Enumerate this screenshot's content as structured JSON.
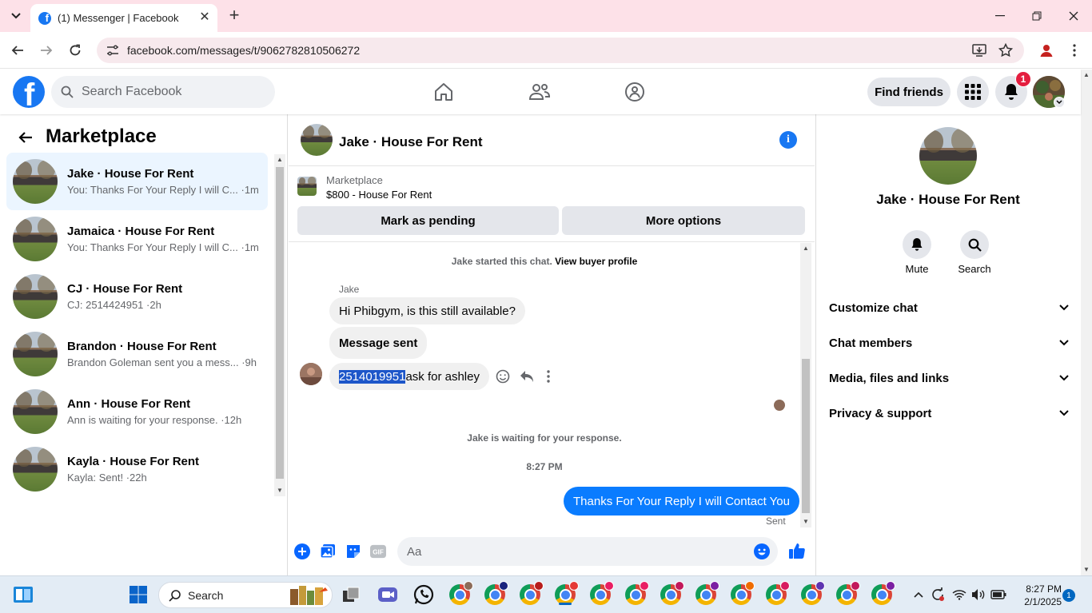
{
  "browser": {
    "tab_title": "(1) Messenger | Facebook",
    "url": "facebook.com/messages/t/9062782810506272"
  },
  "header": {
    "search_placeholder": "Search Facebook",
    "find_friends": "Find friends",
    "notification_count": "1",
    "brand_color": "#1877f2"
  },
  "sidebar": {
    "title": "Marketplace",
    "conversations": [
      {
        "name": "Jake · House For Rent",
        "snippet": "You: Thanks For Your Reply I will C... ·1m"
      },
      {
        "name": "Jamaica · House For Rent",
        "snippet": "You: Thanks For Your Reply I will C... ·1m"
      },
      {
        "name": "CJ · House For Rent",
        "snippet": "CJ: 2514424951 ·2h"
      },
      {
        "name": "Brandon · House For Rent",
        "snippet": "Brandon Goleman sent you a mess... ·9h"
      },
      {
        "name": "Ann · House For Rent",
        "snippet": "Ann is waiting for your response. ·12h"
      },
      {
        "name": "Kayla · House For Rent",
        "snippet": "Kayla: Sent! ·22h"
      }
    ]
  },
  "chat": {
    "title": "Jake · House For Rent",
    "listing_source": "Marketplace",
    "listing": "$800 - House For Rent",
    "mark_pending": "Mark as pending",
    "more_options": "More options",
    "started_prefix": "Jake started this chat.",
    "view_profile": "View buyer profile",
    "sender": "Jake",
    "msg1": "Hi Phibgym, is this still available?",
    "msg2": "Message sent",
    "msg3_selected": "2514019951",
    "msg3_rest": " ask for ashley",
    "waiting": "Jake is waiting for your response.",
    "time": "8:27 PM",
    "my_reply": "Thanks For Your Reply I will Contact You",
    "sent": "Sent",
    "composer_placeholder": "Aa",
    "outgoing_color": "#0a7cff"
  },
  "details": {
    "name": "Jake · House For Rent",
    "mute": "Mute",
    "search": "Search",
    "sections": [
      "Customize chat",
      "Chat members",
      "Media, files and links",
      "Privacy & support"
    ]
  },
  "taskbar": {
    "search": "Search",
    "time": "8:27 PM",
    "date": "2/1/2025",
    "notif": "1"
  }
}
